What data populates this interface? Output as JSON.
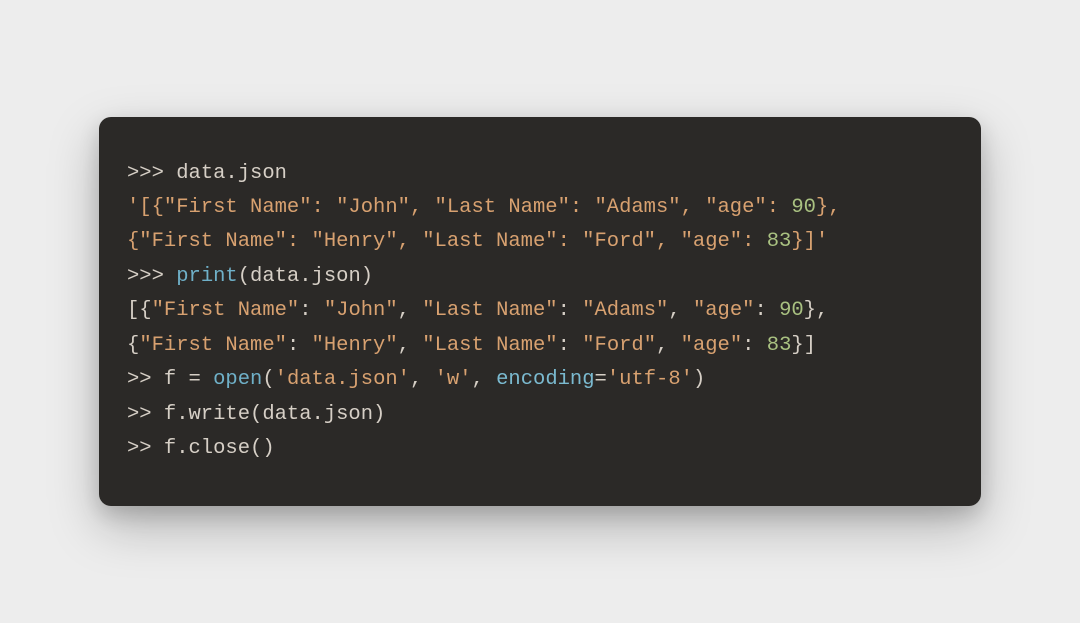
{
  "code": {
    "lines": [
      {
        "segments": [
          {
            "cls": "prompt",
            "text": ">>> "
          },
          {
            "cls": "default",
            "text": "data.json"
          }
        ]
      },
      {
        "segments": [
          {
            "cls": "string",
            "text": "'[{\"First Name\": \"John\", \"Last Name\": \"Adams\", \"age\": "
          },
          {
            "cls": "number",
            "text": "90"
          },
          {
            "cls": "string",
            "text": "}, "
          }
        ]
      },
      {
        "segments": [
          {
            "cls": "string",
            "text": "{\"First Name\": \"Henry\", \"Last Name\": \"Ford\", \"age\": "
          },
          {
            "cls": "number",
            "text": "83"
          },
          {
            "cls": "string",
            "text": "}]'"
          }
        ]
      },
      {
        "segments": [
          {
            "cls": "prompt",
            "text": ">>> "
          },
          {
            "cls": "func",
            "text": "print"
          },
          {
            "cls": "default",
            "text": "(data.json)"
          }
        ]
      },
      {
        "segments": [
          {
            "cls": "default",
            "text": "[{"
          },
          {
            "cls": "string",
            "text": "\"First Name\""
          },
          {
            "cls": "default",
            "text": ": "
          },
          {
            "cls": "string",
            "text": "\"John\""
          },
          {
            "cls": "default",
            "text": ", "
          },
          {
            "cls": "string",
            "text": "\"Last Name\""
          },
          {
            "cls": "default",
            "text": ": "
          },
          {
            "cls": "string",
            "text": "\"Adams\""
          },
          {
            "cls": "default",
            "text": ", "
          },
          {
            "cls": "string",
            "text": "\"age\""
          },
          {
            "cls": "default",
            "text": ": "
          },
          {
            "cls": "number",
            "text": "90"
          },
          {
            "cls": "default",
            "text": "}, "
          }
        ]
      },
      {
        "segments": [
          {
            "cls": "default",
            "text": "{"
          },
          {
            "cls": "string",
            "text": "\"First Name\""
          },
          {
            "cls": "default",
            "text": ": "
          },
          {
            "cls": "string",
            "text": "\"Henry\""
          },
          {
            "cls": "default",
            "text": ", "
          },
          {
            "cls": "string",
            "text": "\"Last Name\""
          },
          {
            "cls": "default",
            "text": ": "
          },
          {
            "cls": "string",
            "text": "\"Ford\""
          },
          {
            "cls": "default",
            "text": ", "
          },
          {
            "cls": "string",
            "text": "\"age\""
          },
          {
            "cls": "default",
            "text": ": "
          },
          {
            "cls": "number",
            "text": "83"
          },
          {
            "cls": "default",
            "text": "}]"
          }
        ]
      },
      {
        "segments": [
          {
            "cls": "prompt",
            "text": ">> "
          },
          {
            "cls": "default",
            "text": "f = "
          },
          {
            "cls": "func",
            "text": "open"
          },
          {
            "cls": "default",
            "text": "("
          },
          {
            "cls": "string",
            "text": "'data.json'"
          },
          {
            "cls": "default",
            "text": ", "
          },
          {
            "cls": "string",
            "text": "'w'"
          },
          {
            "cls": "default",
            "text": ", "
          },
          {
            "cls": "kwarg",
            "text": "encoding"
          },
          {
            "cls": "default",
            "text": "="
          },
          {
            "cls": "string",
            "text": "'utf-8'"
          },
          {
            "cls": "default",
            "text": ")"
          }
        ]
      },
      {
        "segments": [
          {
            "cls": "prompt",
            "text": ">> "
          },
          {
            "cls": "default",
            "text": "f.write(data.json)"
          }
        ]
      },
      {
        "segments": [
          {
            "cls": "prompt",
            "text": ">> "
          },
          {
            "cls": "default",
            "text": "f.close()"
          }
        ]
      }
    ]
  }
}
